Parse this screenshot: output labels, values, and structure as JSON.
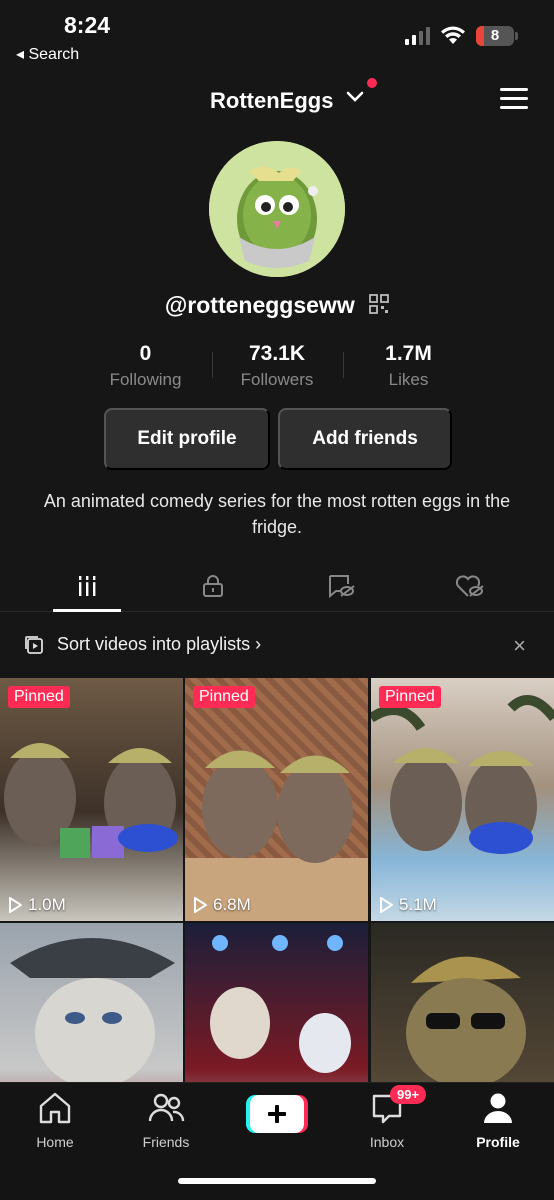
{
  "status_bar": {
    "time": "8:24",
    "back_label": "◂ Search",
    "battery": "8"
  },
  "header": {
    "username": "RottenEggs",
    "chevron": "⌄"
  },
  "profile": {
    "handle": "@rotteneggseww",
    "stats": [
      {
        "value": "0",
        "label": "Following"
      },
      {
        "value": "73.1K",
        "label": "Followers"
      },
      {
        "value": "1.7M",
        "label": "Likes"
      }
    ],
    "edit_label": "Edit profile",
    "add_friends_label": "Add friends",
    "bio": "An animated comedy series for the most rotten eggs in the fridge."
  },
  "tabs": [
    "videos-icon",
    "lock-icon",
    "repost-icon",
    "liked-icon"
  ],
  "playlist_bar": {
    "label": "Sort videos into playlists ›",
    "close": "×"
  },
  "videos": [
    {
      "pinned": "Pinned",
      "views": "1.0M"
    },
    {
      "pinned": "Pinned",
      "views": "6.8M"
    },
    {
      "pinned": "Pinned",
      "views": "5.1M"
    },
    {
      "pinned": "",
      "views": ""
    },
    {
      "pinned": "",
      "views": ""
    },
    {
      "pinned": "",
      "views": ""
    }
  ],
  "bottom_nav": {
    "home": "Home",
    "friends": "Friends",
    "inbox": "Inbox",
    "inbox_badge": "99+",
    "profile": "Profile"
  },
  "colors": {
    "accent": "#fe2c55",
    "background": "#161616",
    "button": "#2f2f2f"
  }
}
